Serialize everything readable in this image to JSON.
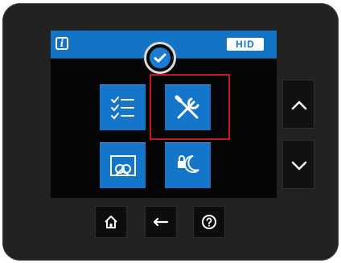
{
  "screen": {
    "header": {
      "info_icon": "info-icon",
      "brand_logo": "HID",
      "status_icon": "check-circle-icon"
    },
    "tiles": [
      {
        "name": "checklist",
        "icon": "checklist-icon"
      },
      {
        "name": "settings-tools",
        "icon": "tools-icon",
        "highlighted": true
      },
      {
        "name": "image-linked",
        "icon": "image-link-icon"
      },
      {
        "name": "lock-sleep",
        "icon": "lock-moon-icon"
      }
    ]
  },
  "side_controls": {
    "up_icon": "chevron-up-icon",
    "down_icon": "chevron-down-icon"
  },
  "bottom_controls": {
    "home_icon": "home-icon",
    "back_icon": "back-arrow-icon",
    "help_icon": "help-icon"
  },
  "colors": {
    "tile_blue": "#1576c9",
    "header_blue": "#1573c6",
    "highlight_red": "#c21a1a",
    "device_body": "#222222"
  }
}
